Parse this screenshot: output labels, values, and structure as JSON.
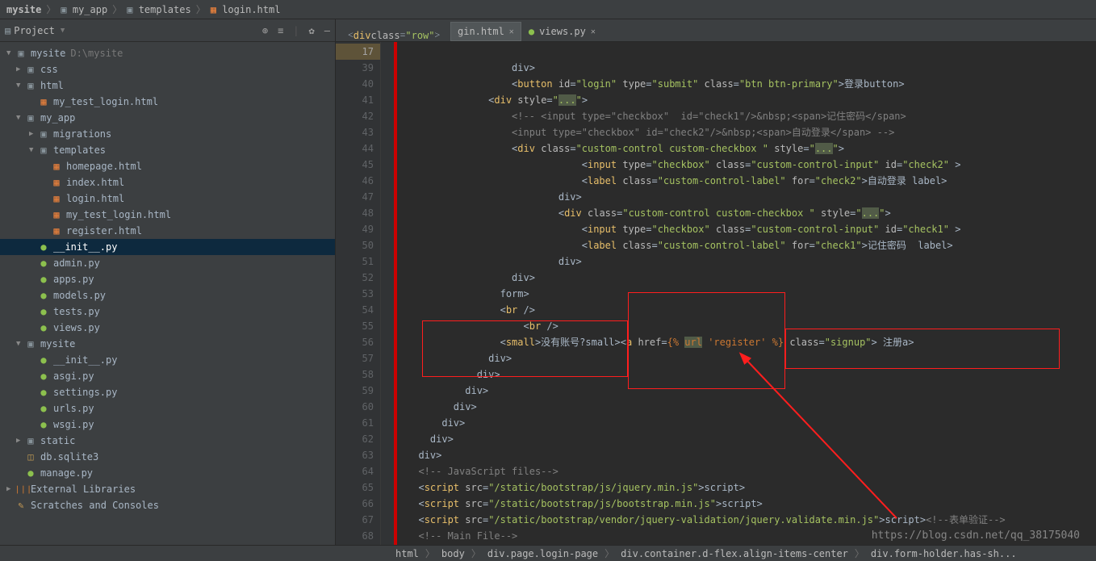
{
  "breadcrumb": [
    "mysite",
    "my_app",
    "templates",
    "login.html"
  ],
  "sidebar": {
    "title": "Project",
    "items": [
      {
        "ind": 0,
        "arrow": "▼",
        "icon": "proj",
        "label": "mysite",
        "dim": "D:\\mysite"
      },
      {
        "ind": 1,
        "arrow": "▶",
        "icon": "folder",
        "label": "css"
      },
      {
        "ind": 1,
        "arrow": "▼",
        "icon": "folder",
        "label": "html"
      },
      {
        "ind": 2,
        "arrow": "",
        "icon": "html",
        "label": "my_test_login.html"
      },
      {
        "ind": 1,
        "arrow": "▼",
        "icon": "folder",
        "label": "my_app"
      },
      {
        "ind": 2,
        "arrow": "▶",
        "icon": "folder",
        "label": "migrations"
      },
      {
        "ind": 2,
        "arrow": "▼",
        "icon": "folder",
        "label": "templates"
      },
      {
        "ind": 3,
        "arrow": "",
        "icon": "html",
        "label": "homepage.html"
      },
      {
        "ind": 3,
        "arrow": "",
        "icon": "html",
        "label": "index.html"
      },
      {
        "ind": 3,
        "arrow": "",
        "icon": "html",
        "label": "login.html"
      },
      {
        "ind": 3,
        "arrow": "",
        "icon": "html",
        "label": "my_test_login.html"
      },
      {
        "ind": 3,
        "arrow": "",
        "icon": "html",
        "label": "register.html"
      },
      {
        "ind": 2,
        "arrow": "",
        "icon": "py",
        "label": "__init__.py",
        "selected": true
      },
      {
        "ind": 2,
        "arrow": "",
        "icon": "py",
        "label": "admin.py"
      },
      {
        "ind": 2,
        "arrow": "",
        "icon": "py",
        "label": "apps.py"
      },
      {
        "ind": 2,
        "arrow": "",
        "icon": "py",
        "label": "models.py"
      },
      {
        "ind": 2,
        "arrow": "",
        "icon": "py",
        "label": "tests.py"
      },
      {
        "ind": 2,
        "arrow": "",
        "icon": "py",
        "label": "views.py"
      },
      {
        "ind": 1,
        "arrow": "▼",
        "icon": "folder",
        "label": "mysite"
      },
      {
        "ind": 2,
        "arrow": "",
        "icon": "py",
        "label": "__init__.py"
      },
      {
        "ind": 2,
        "arrow": "",
        "icon": "py",
        "label": "asgi.py"
      },
      {
        "ind": 2,
        "arrow": "",
        "icon": "py",
        "label": "settings.py"
      },
      {
        "ind": 2,
        "arrow": "",
        "icon": "py",
        "label": "urls.py"
      },
      {
        "ind": 2,
        "arrow": "",
        "icon": "py",
        "label": "wsgi.py"
      },
      {
        "ind": 1,
        "arrow": "▶",
        "icon": "folder",
        "label": "static"
      },
      {
        "ind": 1,
        "arrow": "",
        "icon": "db",
        "label": "db.sqlite3"
      },
      {
        "ind": 1,
        "arrow": "",
        "icon": "py",
        "label": "manage.py"
      },
      {
        "ind": 0,
        "arrow": "▶",
        "icon": "lib",
        "label": "External Libraries"
      },
      {
        "ind": 0,
        "arrow": "",
        "icon": "scratch",
        "label": "Scratches and Consoles"
      }
    ]
  },
  "tabs": [
    {
      "icon": "html",
      "label": "gin.html",
      "active": true,
      "hover_text": "<div class=\"row\">"
    },
    {
      "icon": "py",
      "label": "views.py",
      "active": false
    }
  ],
  "code": {
    "lines": [
      {
        "n": 17
      },
      {
        "n": 39,
        "html": "                  </<t>div</t>>"
      },
      {
        "n": 40,
        "html": "                  <<t>button</t> <a>id</a>=<v>\"login\"</v> <a>type</a>=<v>\"submit\"</v> <a>class</a>=<v>\"btn btn-primary\"</v>>登录</<t>button</t>>"
      },
      {
        "n": 41,
        "html": "              <<t>div</t> <a>style</a>=<v>\"<h>...</h>\"</v>>"
      },
      {
        "n": 42,
        "html": "                  <c>&lt;!-- &lt;input type=\"checkbox\"  id=\"check1\"/&gt;&amp;nbsp;&lt;span&gt;记住密码&lt;/span&gt;</c>"
      },
      {
        "n": 43,
        "html": "<c>                  &lt;input type=\"checkbox\" id=\"check2\"/&gt;&amp;nbsp;&lt;span&gt;自动登录&lt;/span&gt; --&gt;</c>"
      },
      {
        "n": 44,
        "html": "                  <<t>div</t> <a>class</a>=<v>\"custom-control custom-checkbox \"</v> <a>style</a>=<v>\"<h>...</h>\"</v>>"
      },
      {
        "n": 45,
        "html": "                              <<t>input</t> <a>type</a>=<v>\"checkbox\"</v> <a>class</a>=<v>\"custom-control-input\"</v> <a>id</a>=<v>\"check2\"</v> >"
      },
      {
        "n": 46,
        "html": "                              <<t>label</t> <a>class</a>=<v>\"custom-control-label\"</v> <a>for</a>=<v>\"check2\"</v>>自动登录 </<t>label</t>>"
      },
      {
        "n": 47,
        "html": "                          </<t>div</t>>"
      },
      {
        "n": 48,
        "html": "                          <<t>div</t> <a>class</a>=<v>\"custom-control custom-checkbox \"</v> <a>style</a>=<v>\"<h>...</h>\"</v>>"
      },
      {
        "n": 49,
        "html": "                              <<t>input</t> <a>type</a>=<v>\"checkbox\"</v> <a>class</a>=<v>\"custom-control-input\"</v> <a>id</a>=<v>\"check1\"</v> >"
      },
      {
        "n": 50,
        "html": "                              <<t>label</t> <a>class</a>=<v>\"custom-control-label\"</v> <a>for</a>=<v>\"check1\"</v>>记住密码  </<t>label</t>>"
      },
      {
        "n": 51,
        "html": "                          </<t>div</t>>"
      },
      {
        "n": 52,
        "html": "                  </<t>div</t>>"
      },
      {
        "n": 53,
        "html": "                </<t>form</t>>"
      },
      {
        "n": 54,
        "html": "                <<t>br</t> />"
      },
      {
        "n": 55,
        "html": "                    <<t>br</t> />"
      },
      {
        "n": 56,
        "html": "                <<t>small</t>>没有账号?</<t>small</t>><<t>a</t> <a>href</a>=<d>{% </d><dh>url</dh><d> 'register' %}</d> <a>class</a>=<v>\"signup\"</v>> 注册</<t>a</t>>"
      },
      {
        "n": 57,
        "html": "              </<t>div</t>>"
      },
      {
        "n": 58,
        "html": "            </<t>div</t>>"
      },
      {
        "n": 59,
        "html": "          </<t>div</t>>"
      },
      {
        "n": 60,
        "html": "        </<t>div</t>>"
      },
      {
        "n": 61,
        "html": "      </<t>div</t>>"
      },
      {
        "n": 62,
        "html": "    </<t>div</t>>"
      },
      {
        "n": 63,
        "html": "  </<t>div</t>>"
      },
      {
        "n": 64,
        "html": "  <c>&lt;!-- JavaScript files--&gt;</c>"
      },
      {
        "n": 65,
        "html": "  <<t>script</t> <a>src</a>=<v>\"/static/bootstrap/js/jquery.min.js\"</v>></<t>script</t>>"
      },
      {
        "n": 66,
        "html": "  <<t>script</t> <a>src</a>=<v>\"/static/bootstrap/js/bootstrap.min.js\"</v>></<t>script</t>>"
      },
      {
        "n": 67,
        "html": "  <<t>script</t> <a>src</a>=<v>\"/static/bootstrap/vendor/jquery-validation/jquery.validate.min.js\"</v>></<t>script</t>><c>&lt;!--表单验证--&gt;</c>"
      },
      {
        "n": 68,
        "html": "  <c>&lt;!-- Main File--&gt;</c>"
      }
    ]
  },
  "bottom_breadcrumb": [
    "html",
    "body",
    "div.page.login-page",
    "div.container.d-flex.align-items-center",
    "div.form-holder.has-sh..."
  ],
  "watermark": "https://blog.csdn.net/qq_38175040"
}
